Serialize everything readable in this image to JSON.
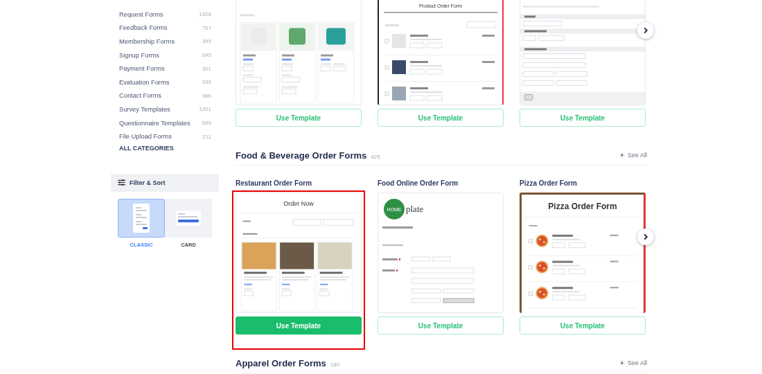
{
  "sidebar": {
    "categories": [
      {
        "label": "Request Forms",
        "count": "1428"
      },
      {
        "label": "Feedback Forms",
        "count": "757"
      },
      {
        "label": "Membership Forms",
        "count": "399"
      },
      {
        "label": "Signup Forms",
        "count": "645"
      },
      {
        "label": "Payment Forms",
        "count": "301"
      },
      {
        "label": "Evaluation Forms",
        "count": "936"
      },
      {
        "label": "Contact Forms",
        "count": "986"
      },
      {
        "label": "Survey Templates",
        "count": "1201"
      },
      {
        "label": "Questionnaire Templates",
        "count": "599"
      },
      {
        "label": "File Upload Forms",
        "count": "211"
      }
    ],
    "all_categories": "ALL CATEGORIES",
    "filter_button": "Filter & Sort",
    "view_modes": [
      {
        "label": "CLASSIC",
        "kind": "classic",
        "selected": true
      },
      {
        "label": "CARD",
        "kind": "card",
        "selected": false
      }
    ]
  },
  "top_row": {
    "cards": [
      {
        "highlighted": false,
        "button": "Use Template",
        "preview": {
          "kind": "product-grid"
        }
      },
      {
        "highlighted": false,
        "button": "Use Template",
        "preview": {
          "kind": "product-list",
          "title": "Product Order Form"
        }
      },
      {
        "highlighted": false,
        "button": "Use Template",
        "preview": {
          "kind": "billing-form"
        }
      }
    ]
  },
  "sections": [
    {
      "title": "Food & Beverage Order Forms",
      "count": "425",
      "see_all": "See All",
      "cards": [
        {
          "title": "Restaurant Order Form",
          "highlighted": true,
          "button": "Use Template",
          "preview": {
            "kind": "restaurant-menu",
            "title": "Order Now"
          }
        },
        {
          "title": "Food Online Order Form",
          "highlighted": false,
          "button": "Use Template",
          "preview": {
            "kind": "online-ordering",
            "logo_circle": "HOME",
            "logo_word": "plate"
          }
        },
        {
          "title": "Pizza Order Form",
          "highlighted": false,
          "button": "Use Template",
          "preview": {
            "kind": "pizza-menu",
            "title": "Pizza Order Form"
          }
        }
      ]
    },
    {
      "title": "Apparel Order Forms",
      "count": "180",
      "see_all": "See All"
    }
  ]
}
